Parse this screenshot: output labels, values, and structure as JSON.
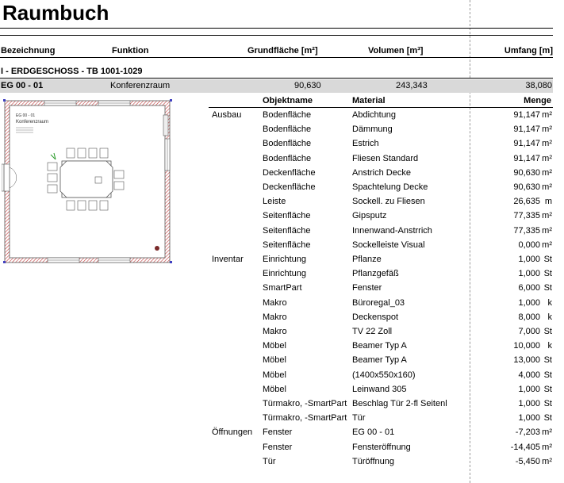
{
  "title": "Raumbuch",
  "columns": {
    "bezeichnung": "Bezeichnung",
    "funktion": "Funktion",
    "grundflaeche": "Grundfläche [m²]",
    "volumen": "Volumen [m³]",
    "umfang": "Umfang [m]"
  },
  "section": "I - ERDGESCHOSS - TB 1001-1029",
  "room": {
    "id": "EG 00 - 01",
    "function": "Konferenzraum",
    "area": "90,630",
    "volume": "243,343",
    "perimeter": "38,080"
  },
  "plan": {
    "label_id": "EG 00 - 01",
    "label_name": "Konferenzraum"
  },
  "detail_headers": {
    "object": "Objektname",
    "material": "Material",
    "quantity": "Menge"
  },
  "rows": [
    {
      "group": "Ausbau",
      "object": "Bodenfläche",
      "material": "Abdichtung",
      "value": "91,147",
      "unit": "m²"
    },
    {
      "group": "",
      "object": "Bodenfläche",
      "material": "Dämmung",
      "value": "91,147",
      "unit": "m²"
    },
    {
      "group": "",
      "object": "Bodenfläche",
      "material": "Estrich",
      "value": "91,147",
      "unit": "m²"
    },
    {
      "group": "",
      "object": "Bodenfläche",
      "material": "Fliesen Standard",
      "value": "91,147",
      "unit": "m²"
    },
    {
      "group": "",
      "object": "Deckenfläche",
      "material": "Anstrich Decke",
      "value": "90,630",
      "unit": "m²"
    },
    {
      "group": "",
      "object": "Deckenfläche",
      "material": "Spachtelung Decke",
      "value": "90,630",
      "unit": "m²"
    },
    {
      "group": "",
      "object": "Leiste",
      "material": "Sockell. zu Fliesen",
      "value": "26,635",
      "unit": "m"
    },
    {
      "group": "",
      "object": "Seitenfläche",
      "material": "Gipsputz",
      "value": "77,335",
      "unit": "m²"
    },
    {
      "group": "",
      "object": "Seitenfläche",
      "material": "Innenwand-Anstrrich",
      "value": "77,335",
      "unit": "m²"
    },
    {
      "group": "",
      "object": "Seitenfläche",
      "material": "Sockelleiste Visual",
      "value": "0,000",
      "unit": "m²"
    },
    {
      "group": "Inventar",
      "object": "Einrichtung",
      "material": "Pflanze",
      "value": "1,000",
      "unit": "St"
    },
    {
      "group": "",
      "object": "Einrichtung",
      "material": "Pflanzgefäß",
      "value": "1,000",
      "unit": "St"
    },
    {
      "group": "",
      "object": "SmartPart",
      "material": "Fenster",
      "value": "6,000",
      "unit": "St"
    },
    {
      "group": "",
      "object": "Makro",
      "material": "Büroregal_03",
      "value": "1,000",
      "unit": "k"
    },
    {
      "group": "",
      "object": "Makro",
      "material": "Deckenspot",
      "value": "8,000",
      "unit": "k"
    },
    {
      "group": "",
      "object": "Makro",
      "material": "TV 22 Zoll",
      "value": "7,000",
      "unit": "St"
    },
    {
      "group": "",
      "object": "Möbel",
      "material": "Beamer Typ A",
      "value": "10,000",
      "unit": "k"
    },
    {
      "group": "",
      "object": "Möbel",
      "material": "Beamer Typ A",
      "value": "13,000",
      "unit": "St"
    },
    {
      "group": "",
      "object": "Möbel",
      "material": "(1400x550x160)",
      "value": "4,000",
      "unit": "St"
    },
    {
      "group": "",
      "object": "Möbel",
      "material": "Leinwand 305",
      "value": "1,000",
      "unit": "St"
    },
    {
      "group": "",
      "object": "Türmakro, -SmartPart",
      "material": "Beschlag Tür 2-fl Seitenl",
      "value": "1,000",
      "unit": "St"
    },
    {
      "group": "",
      "object": "Türmakro, -SmartPart",
      "material": "Tür",
      "value": "1,000",
      "unit": "St"
    },
    {
      "group": "Öffnungen",
      "object": "Fenster",
      "material": "EG 00 - 01",
      "value": "-7,203",
      "unit": "m²"
    },
    {
      "group": "",
      "object": "Fenster",
      "material": "Fensteröffnung",
      "value": "-14,405",
      "unit": "m²"
    },
    {
      "group": "",
      "object": "Tür",
      "material": "Türöffnung",
      "value": "-5,450",
      "unit": "m²"
    }
  ]
}
